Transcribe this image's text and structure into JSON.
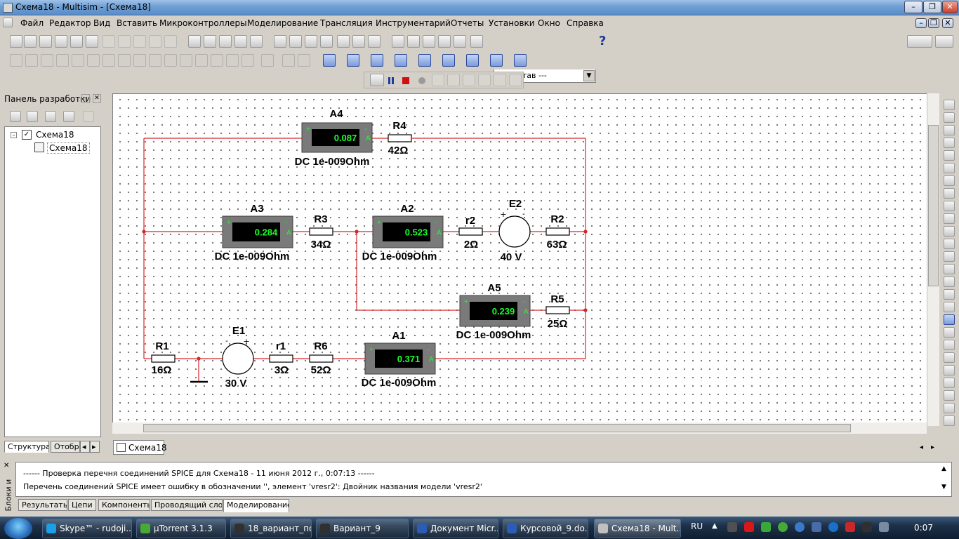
{
  "window": {
    "title": "Схема18 - Multisim - [Схема18]"
  },
  "menu": [
    "Файл",
    "Редактор",
    "Вид",
    "Вставить",
    "Микроконтроллеры",
    "Моделирование",
    "Трансляция",
    "Инструментарий",
    "Отчеты",
    "Установки",
    "Окно",
    "Справка"
  ],
  "toolbar": {
    "combo_value": "--- Состав ---",
    "help_label": "?"
  },
  "design_panel": {
    "title": "Панель разработки",
    "tree_root": "Схема18",
    "tree_child": "Схема18",
    "tabs": [
      "Структура",
      "Отобр"
    ]
  },
  "circuit": {
    "ammeters": [
      {
        "name": "A4",
        "reading": "0.087",
        "mode": "DC  1e-009Ohm"
      },
      {
        "name": "A3",
        "reading": "0.284",
        "mode": "DC  1e-009Ohm"
      },
      {
        "name": "A2",
        "reading": "0.523",
        "mode": "DC  1e-009Ohm"
      },
      {
        "name": "A5",
        "reading": "0.239",
        "mode": "DC  1e-009Ohm"
      },
      {
        "name": "A1",
        "reading": "0.371",
        "mode": "DC  1e-009Ohm"
      }
    ],
    "resistors": [
      {
        "name": "R4",
        "value": "42Ω"
      },
      {
        "name": "R3",
        "value": "34Ω"
      },
      {
        "name": "r2",
        "value": "2Ω"
      },
      {
        "name": "R2",
        "value": "63Ω"
      },
      {
        "name": "R5",
        "value": "25Ω"
      },
      {
        "name": "R1",
        "value": "16Ω"
      },
      {
        "name": "r1",
        "value": "3Ω"
      },
      {
        "name": "R6",
        "value": "52Ω"
      }
    ],
    "sources": [
      {
        "name": "E2",
        "value": "40 V"
      },
      {
        "name": "E1",
        "value": "30 V"
      }
    ],
    "terminal_plus": "+",
    "terminal_minus": "-",
    "terminal_a": "A"
  },
  "sheet_tab": "Схема18",
  "output": {
    "line1": "------ Проверка перечня соединений SPICE для Схема18 - 11 июня 2012 г., 0:07:13 ------",
    "line2": "Перечень соединений SPICE имеет ошибку в обозначении '', элемент 'vresr2':  Двойник названия модели 'vresr2'",
    "side_label": "Блоки и",
    "tabs": [
      "Результаты",
      "Цепи",
      "Компоненты",
      "Проводящий слой",
      "Моделирование"
    ]
  },
  "taskbar": {
    "items": [
      "Skype™ - rudoji...",
      "µTorrent 3.1.3",
      "18_вариант_по...",
      "Вариант_9",
      "Документ Micr...",
      "Курсовой_9.do...",
      "Схема18 - Mult..."
    ],
    "lang": "RU",
    "clock": "0:07"
  },
  "colors": {
    "wire": "#d6262a",
    "meter_reading": "#1aff2a",
    "title_bar": "#6f9fd3",
    "taskbar": "#1d3148"
  }
}
